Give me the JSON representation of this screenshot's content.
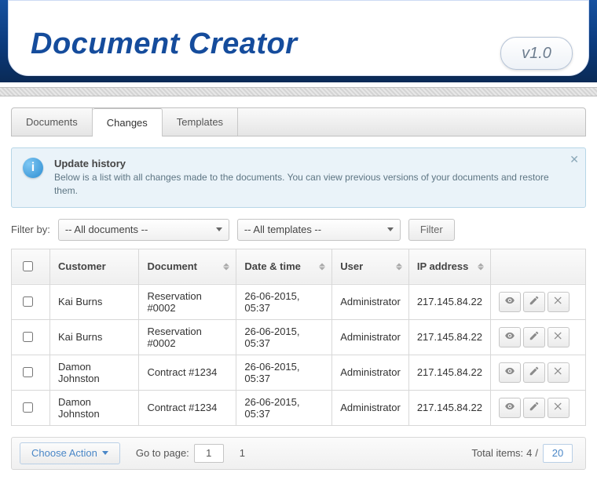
{
  "app": {
    "title": "Document Creator",
    "version": "v1.0"
  },
  "tabs": [
    "Documents",
    "Changes",
    "Templates"
  ],
  "active_tab": 1,
  "infobox": {
    "title": "Update history",
    "body": "Below is a list with all changes made to the documents. You can view previous versions of your documents and restore them."
  },
  "filter": {
    "label": "Filter by:",
    "documents_select": "-- All documents --",
    "templates_select": "-- All templates --",
    "filter_button": "Filter"
  },
  "table": {
    "headers": [
      "Customer",
      "Document",
      "Date & time",
      "User",
      "IP address"
    ],
    "rows": [
      {
        "customer": "Kai Burns",
        "document": "Reservation #0002",
        "datetime": "26-06-2015, 05:37",
        "user": "Administrator",
        "ip": "217.145.84.22"
      },
      {
        "customer": "Kai Burns",
        "document": "Reservation #0002",
        "datetime": "26-06-2015, 05:37",
        "user": "Administrator",
        "ip": "217.145.84.22"
      },
      {
        "customer": "Damon Johnston",
        "document": "Contract #1234",
        "datetime": "26-06-2015, 05:37",
        "user": "Administrator",
        "ip": "217.145.84.22"
      },
      {
        "customer": "Damon Johnston",
        "document": "Contract #1234",
        "datetime": "26-06-2015, 05:37",
        "user": "Administrator",
        "ip": "217.145.84.22"
      }
    ]
  },
  "footer": {
    "choose_action": "Choose Action",
    "goto_label": "Go to page:",
    "page": "1",
    "total_pages": "1",
    "total_label": "Total items:",
    "total_items": "4",
    "per_page": "20"
  }
}
